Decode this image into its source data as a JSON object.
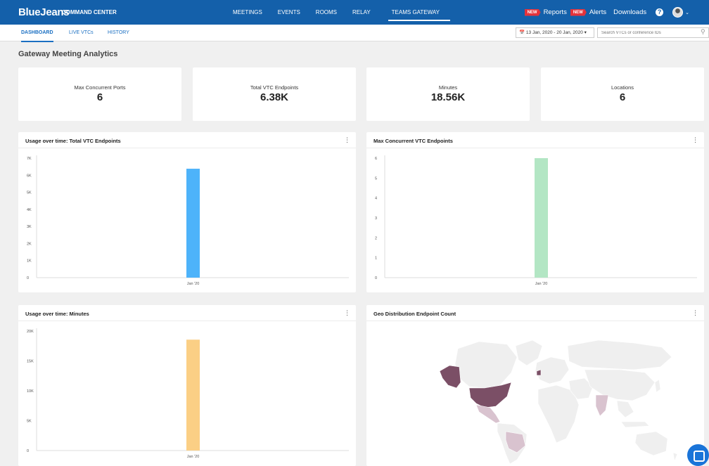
{
  "header": {
    "brand": "BlueJeans",
    "app_name": "COMMAND CENTER",
    "nav": [
      {
        "label": "MEETINGS"
      },
      {
        "label": "EVENTS"
      },
      {
        "label": "ROOMS"
      },
      {
        "label": "RELAY"
      },
      {
        "label": "TEAMS GATEWAY",
        "active": true
      }
    ],
    "new_badge": "NEW",
    "reports": "Reports",
    "alerts": "Alerts",
    "downloads": "Downloads",
    "help": "?",
    "icons": [
      "help-icon",
      "avatar",
      "chevron-down-icon"
    ]
  },
  "subnav": {
    "tabs": [
      {
        "label": "DASHBOARD",
        "active": true
      },
      {
        "label": "LIVE VTCs"
      },
      {
        "label": "HISTORY"
      }
    ],
    "date_range": "13 Jan, 2020 - 20 Jan, 2020",
    "search_placeholder": "Search VTCs or conference IDs"
  },
  "page_title": "Gateway Meeting Analytics",
  "stats": [
    {
      "label": "Max Concurrent Ports",
      "value": "6"
    },
    {
      "label": "Total VTC Endpoints",
      "value": "6.38K"
    },
    {
      "label": "Minutes",
      "value": "18.56K"
    },
    {
      "label": "Locations",
      "value": "6"
    }
  ],
  "panels": {
    "vtc_endpoints": {
      "title": "Usage over time: Total VTC Endpoints"
    },
    "max_concurrent": {
      "title": "Max Concurrent VTC Endpoints"
    },
    "minutes": {
      "title": "Usage over time: Minutes"
    },
    "geo": {
      "title": "Geo Distribution Endpoint Count"
    }
  },
  "chart_data": [
    {
      "type": "bar",
      "title": "Usage over time: Total VTC Endpoints",
      "categories": [
        "Jan '20"
      ],
      "values": [
        6380
      ],
      "yticks": [
        "0",
        "1K",
        "2K",
        "3K",
        "4K",
        "5K",
        "6K",
        "7K"
      ],
      "ylim": [
        0,
        7000
      ],
      "color": "#4db3fa"
    },
    {
      "type": "bar",
      "title": "Max Concurrent VTC Endpoints",
      "categories": [
        "Jan '20"
      ],
      "values": [
        6
      ],
      "yticks": [
        "0",
        "1",
        "2",
        "3",
        "4",
        "5",
        "6"
      ],
      "ylim": [
        0,
        6
      ],
      "color": "#b3e6c4"
    },
    {
      "type": "bar",
      "title": "Usage over time: Minutes",
      "categories": [
        "Jan '20"
      ],
      "values": [
        18560
      ],
      "yticks": [
        "0",
        "5K",
        "10K",
        "15K",
        "20K"
      ],
      "ylim": [
        0,
        20000
      ],
      "color": "#fbcf85"
    }
  ],
  "colors": {
    "topbar": "#1460aa",
    "map_high": "#7b4f66",
    "map_low": "#d9c3cf",
    "map_base": "#efefef"
  }
}
